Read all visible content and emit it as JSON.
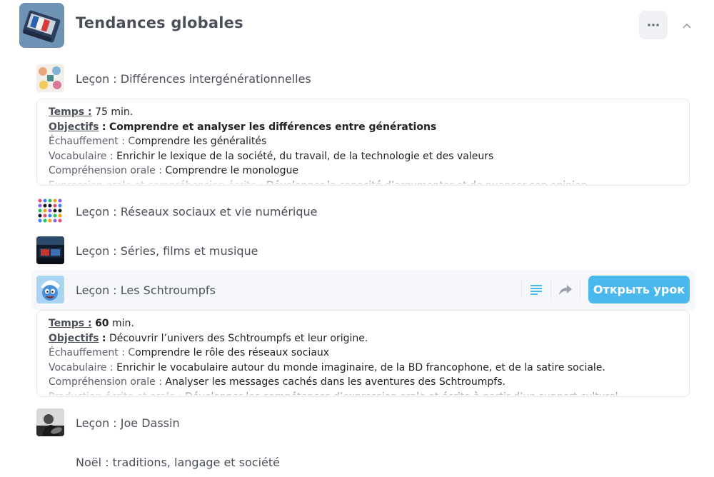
{
  "course": {
    "title": "Tendances globales"
  },
  "lessons": [
    {
      "title": "Leçon : Différences intergénérationnelles"
    },
    {
      "title": "Leçon : Réseaux sociaux et vie numérique"
    },
    {
      "title": "Leçon : Séries, films et musique"
    },
    {
      "title": "Leçon : Les Schtroumpfs"
    },
    {
      "title": "Leçon : Joe Dassin"
    },
    {
      "title": "Noël : traditions, langage et société"
    }
  ],
  "details1": {
    "temps_label": "Temps :",
    "temps_value": "75 min.",
    "objectifs_label": "Objectifs",
    "colon": ":",
    "objectifs_value": "Comprendre et analyser les différences entre générations",
    "echauffement_label": "Échauffement : C",
    "echauffement_value": "omprendre les généralités",
    "vocabulaire_label": "Vocabulaire :",
    "vocabulaire_value": "Enrichir le lexique de la société, du travail, de la technologie et des valeurs",
    "comprehension_label": "Compréhension orale :",
    "comprehension_value": "Comprendre le monologue",
    "expression_label": "Expression orale et compréhension écrite :",
    "expression_value": "Développer la capacité d’argumenter et de nuancer son opinion"
  },
  "details2": {
    "temps_label": "Temps :",
    "temps_value": "60",
    "temps_unit": "min.",
    "objectifs_label": "Objectifs",
    "colon": ":",
    "objectifs_value": "Découvrir l’univers des Schtroumpfs et leur origine.",
    "echauffement_label": "Échauffement : C",
    "echauffement_value": "omprendre le rôle des réseaux sociaux",
    "vocabulaire_label": "Vocabulaire :",
    "vocabulaire_value": "Enrichir le vocabulaire autour du monde imaginaire, de la BD francophone, et de la satire sociale.",
    "comprehension_label": "Compréhension orale :",
    "comprehension_value": "Analyser les messages cachés dans les aventures des Schtroumpfs.",
    "production_label": "Production écrite et orale :",
    "production_value": "Développer les compétences d’expression orale et écrite à partir d’un support culturel"
  },
  "actions": {
    "open_label": "Открыть урок"
  },
  "colors": {
    "accent": "#4ab8ec",
    "row_highlight": "#f5f7fa"
  },
  "icons": [
    "more-icon",
    "chevron-up-icon",
    "text-lines-icon",
    "share-icon"
  ]
}
